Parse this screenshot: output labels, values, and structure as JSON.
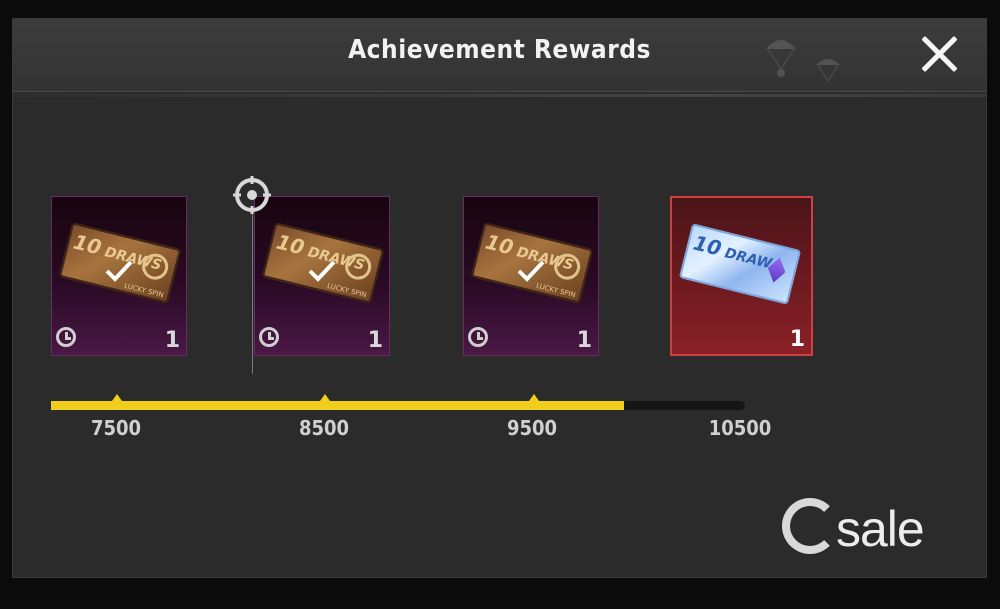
{
  "dialog": {
    "title": "Achievement Rewards",
    "close_icon": "close-icon"
  },
  "rewards": [
    {
      "ticket_count": "10",
      "ticket_word": "DRAWS",
      "ticket_sub": "LUCKY SPIN",
      "quantity": "1",
      "claimed": true,
      "style": "bronze"
    },
    {
      "ticket_count": "10",
      "ticket_word": "DRAWS",
      "ticket_sub": "LUCKY SPIN",
      "quantity": "1",
      "claimed": true,
      "style": "bronze"
    },
    {
      "ticket_count": "10",
      "ticket_word": "DRAWS",
      "ticket_sub": "LUCKY SPIN",
      "quantity": "1",
      "claimed": true,
      "style": "bronze"
    },
    {
      "ticket_count": "10",
      "ticket_word": "DRAW",
      "ticket_sub": "",
      "quantity": "1",
      "claimed": false,
      "style": "blue"
    }
  ],
  "progress": {
    "milestones": [
      "7500",
      "8500",
      "9500",
      "10500"
    ],
    "fill_fraction": 0.825,
    "accent_color": "#f0cf1c"
  },
  "watermark": {
    "text": "sale",
    "icon": "gsale-logo-icon"
  }
}
